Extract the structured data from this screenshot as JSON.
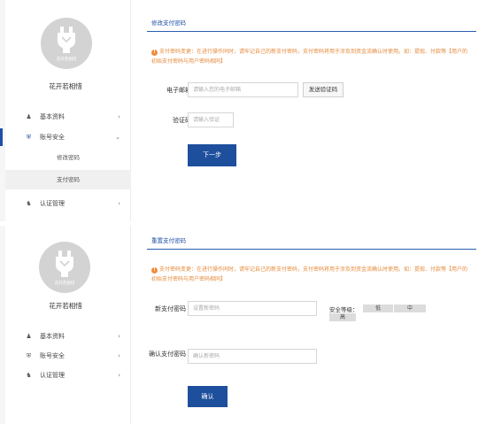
{
  "profile": {
    "avatar_caption": "花开若相惜",
    "username": "花开若相惜"
  },
  "panel1": {
    "nav": {
      "basic_info": "基本资料",
      "account_security": "账号安全",
      "change_password": "修改密码",
      "payment_password": "支付密码",
      "certification": "认证管理"
    },
    "title": "修改支付密码",
    "notice": "支付密码变更：在进行操作同时，请牢记自己的新支付密码，支付密码将用于涉及到资金流确认时使用。如：提现、付款等【用户的初始支付密码与用户密码相同】",
    "email_label": "电子邮箱",
    "email_placeholder": "请输入您的电子邮箱",
    "send_code_button": "发送验证码",
    "code_label": "验证码",
    "code_placeholder": "请输入验证",
    "next_button": "下一步"
  },
  "panel2": {
    "nav": {
      "basic_info": "基本资料",
      "account_security": "账号安全",
      "certification": "认证管理"
    },
    "title": "重置支付密码",
    "notice": "支付密码变更：在进行操作同时，请牢记自己的新支付密码，支付密码将用于涉及到资金流确认时使用。如：提现、付款等【用户的初始支付密码与用户密码相同】",
    "new_password_label": "新支付密码",
    "new_password_placeholder": "设置新密码",
    "strength_label": "安全等级：",
    "strength_levels": [
      "低",
      "中",
      "高"
    ],
    "confirm_label": "确认支付密码",
    "confirm_placeholder": "确认新密码",
    "confirm_button": "确认"
  },
  "colors": {
    "accent": "#1e4f9c",
    "notice": "#e58a3a",
    "avatar_bg": "#d3d3d3"
  },
  "icons": {
    "user": "user-icon",
    "shield": "shield-icon",
    "cert": "certificate-icon",
    "chevron": "chevron-icon",
    "warning": "warning-icon"
  }
}
